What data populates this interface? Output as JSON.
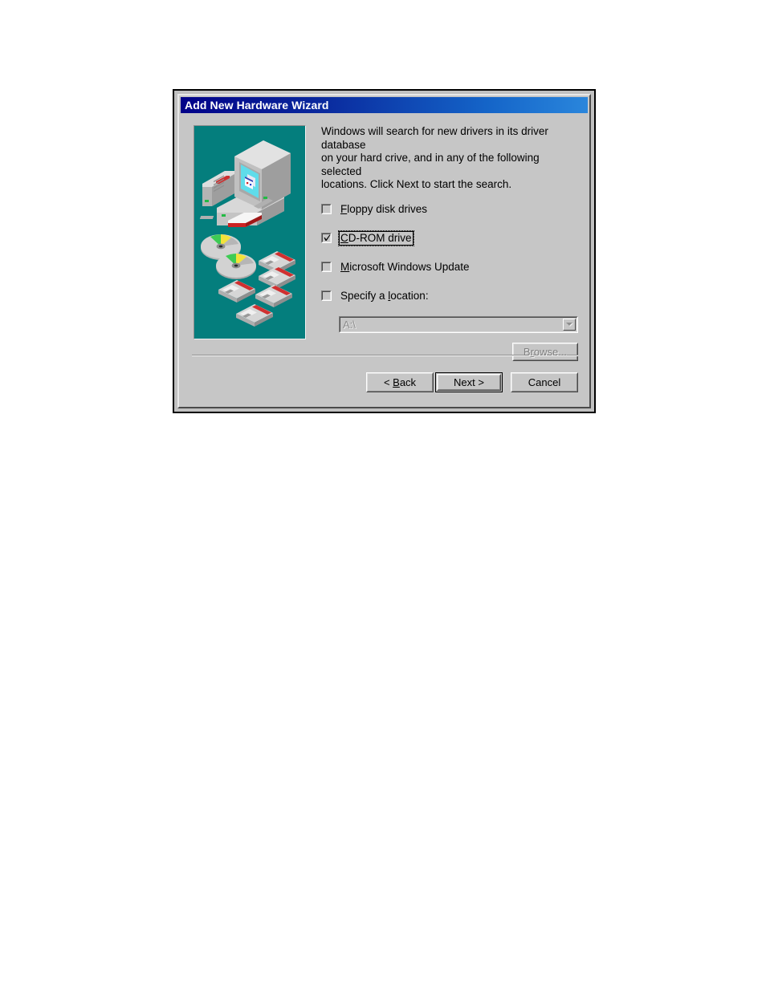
{
  "dialog": {
    "title": "Add New Hardware Wizard",
    "intro_text": "Windows will search for new drivers in its driver database\non your hard crive, and in any of the following selected\nlocations. Click Next to start the search.",
    "illustration_alt": "computer-cds-floppies-illustration"
  },
  "options": [
    {
      "id": "floppy",
      "label_pre": "",
      "accel": "F",
      "label_post": "loppy disk drives",
      "full_label": "Floppy disk drives",
      "checked": false,
      "focused": false
    },
    {
      "id": "cdrom",
      "label_pre": "",
      "accel": "C",
      "label_post": "D-ROM drive",
      "full_label": "CD-ROM drive",
      "checked": true,
      "focused": true
    },
    {
      "id": "windows-update",
      "label_pre": "",
      "accel": "M",
      "label_post": "icrosoft Windows Update",
      "full_label": "Microsoft Windows Update",
      "checked": false,
      "focused": false
    },
    {
      "id": "specify-location",
      "label_pre": "Specify a ",
      "accel": "l",
      "label_post": "ocation:",
      "full_label": "Specify a location:",
      "checked": false,
      "focused": false
    }
  ],
  "location_combo": {
    "value": "A:\\",
    "placeholder": "A:\\",
    "enabled": false,
    "arrow_icon": "chevron-down-icon"
  },
  "browse_button": {
    "label_pre": "B",
    "accel": "r",
    "label_post": "owse...",
    "full_label": "Browse...",
    "enabled": false
  },
  "footer_buttons": [
    {
      "id": "back",
      "label_pre": "< ",
      "accel": "B",
      "label_post": "ack",
      "full_label": "< Back",
      "default": false
    },
    {
      "id": "next",
      "label_pre": "",
      "accel": "",
      "label_post": "Next >",
      "full_label": "Next >",
      "default": true
    },
    {
      "id": "cancel",
      "label_pre": "",
      "accel": "",
      "label_post": "Cancel",
      "full_label": "Cancel",
      "default": false
    }
  ],
  "colors": {
    "titlebar_start": "#020288",
    "titlebar_end": "#2a86dc",
    "dialog_face": "#c6c6c6",
    "illustration_bg": "#047e7d",
    "disabled_text": "#808080"
  }
}
